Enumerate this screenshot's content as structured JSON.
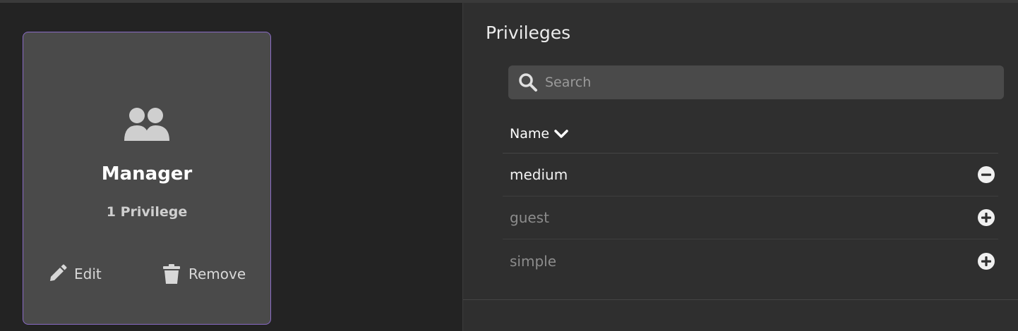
{
  "role_card": {
    "title": "Manager",
    "privilege_count": "1 Privilege",
    "edit_label": "Edit",
    "remove_label": "Remove",
    "icon": "users-icon",
    "accent": "#8a6bc6"
  },
  "privileges_panel": {
    "title": "Privileges",
    "search": {
      "placeholder": "Search",
      "value": ""
    },
    "column_header": "Name",
    "sort_icon": "chevron-down-icon",
    "items": [
      {
        "label": "medium",
        "assigned": true,
        "action_icon": "minus-circle-icon"
      },
      {
        "label": "guest",
        "assigned": false,
        "action_icon": "plus-circle-icon"
      },
      {
        "label": "simple",
        "assigned": false,
        "action_icon": "plus-circle-icon"
      }
    ]
  }
}
